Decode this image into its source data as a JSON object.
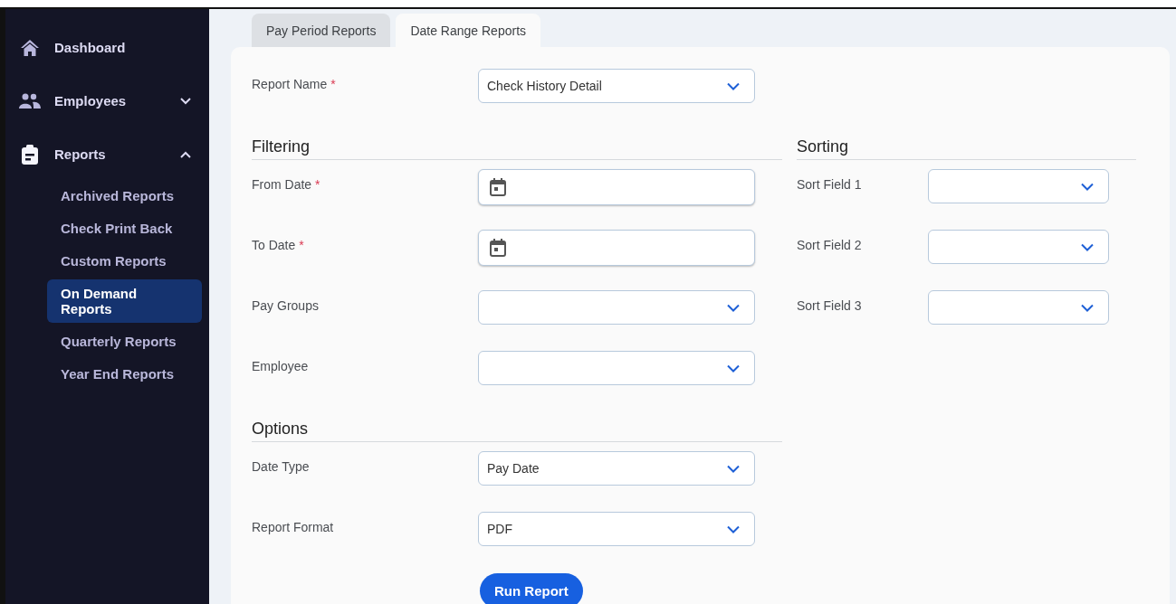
{
  "sidebar": {
    "items": [
      {
        "label": "Dashboard"
      },
      {
        "label": "Employees",
        "expanded": false
      },
      {
        "label": "Reports",
        "expanded": true,
        "children": [
          {
            "label": "Archived Reports",
            "selected": false
          },
          {
            "label": "Check Print Back",
            "selected": false
          },
          {
            "label": "Custom Reports",
            "selected": false
          },
          {
            "label": "On Demand Reports",
            "selected": true
          },
          {
            "label": "Quarterly Reports",
            "selected": false
          },
          {
            "label": "Year End Reports",
            "selected": false
          }
        ]
      }
    ]
  },
  "tabs": [
    {
      "label": "Pay Period Reports",
      "selected": false
    },
    {
      "label": "Date Range Reports",
      "selected": true
    }
  ],
  "report_name": {
    "label": "Report Name",
    "required_mark": "*",
    "kind": "select",
    "value": "Check History Detail"
  },
  "filtering": {
    "title": "Filtering",
    "fields": [
      {
        "label": "From Date",
        "required_mark": "*",
        "kind": "date"
      },
      {
        "label": "To Date",
        "required_mark": "*",
        "kind": "date"
      },
      {
        "label": "Pay Groups",
        "kind": "select"
      },
      {
        "label": "Employee",
        "kind": "select"
      }
    ]
  },
  "options": {
    "title": "Options",
    "fields": [
      {
        "label": "Date Type",
        "kind": "select",
        "value": "Pay Date"
      },
      {
        "label": "Report Format",
        "kind": "select",
        "value": "PDF"
      }
    ]
  },
  "sorting": {
    "title": "Sorting",
    "fields": [
      {
        "label": "Sort Field 1",
        "kind": "select"
      },
      {
        "label": "Sort Field 2",
        "kind": "select"
      },
      {
        "label": "Sort Field 3",
        "kind": "select"
      }
    ]
  },
  "run_button": {
    "label": "Run Report"
  }
}
